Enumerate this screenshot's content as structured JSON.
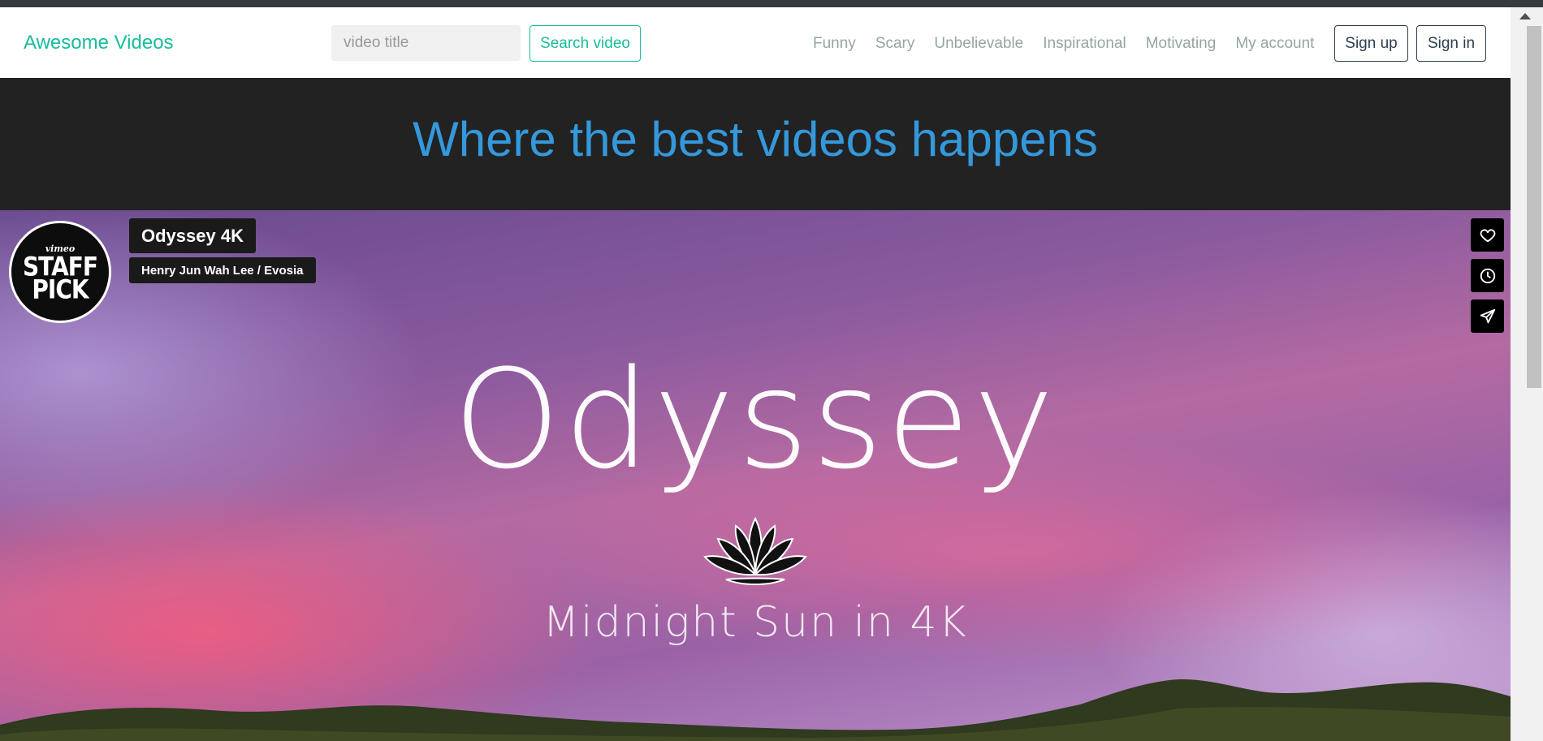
{
  "navbar": {
    "brand": "Awesome Videos",
    "search": {
      "placeholder": "video title",
      "value": ""
    },
    "search_button": "Search video",
    "links": [
      "Funny",
      "Scary",
      "Unbelievable",
      "Inspirational",
      "Motivating",
      "My account"
    ],
    "sign_up": "Sign up",
    "sign_in": "Sign in"
  },
  "hero": {
    "title": "Where the best videos happens"
  },
  "video": {
    "badge": {
      "vimeo": "vimeo",
      "line1": "STAFF",
      "line2": "PICK"
    },
    "title": "Odyssey 4K",
    "author": "Henry Jun Wah Lee / Evosia",
    "overlay_title": "Odyssey",
    "overlay_subtitle": "Midnight Sun in 4K",
    "actions": [
      "heart-icon",
      "clock-icon",
      "send-icon"
    ]
  },
  "colors": {
    "brand": "#18bc9c",
    "hero_title": "#3498db",
    "hero_bg": "#222222",
    "nav_link": "#95a5a6",
    "auth_border": "#2c3e50"
  }
}
